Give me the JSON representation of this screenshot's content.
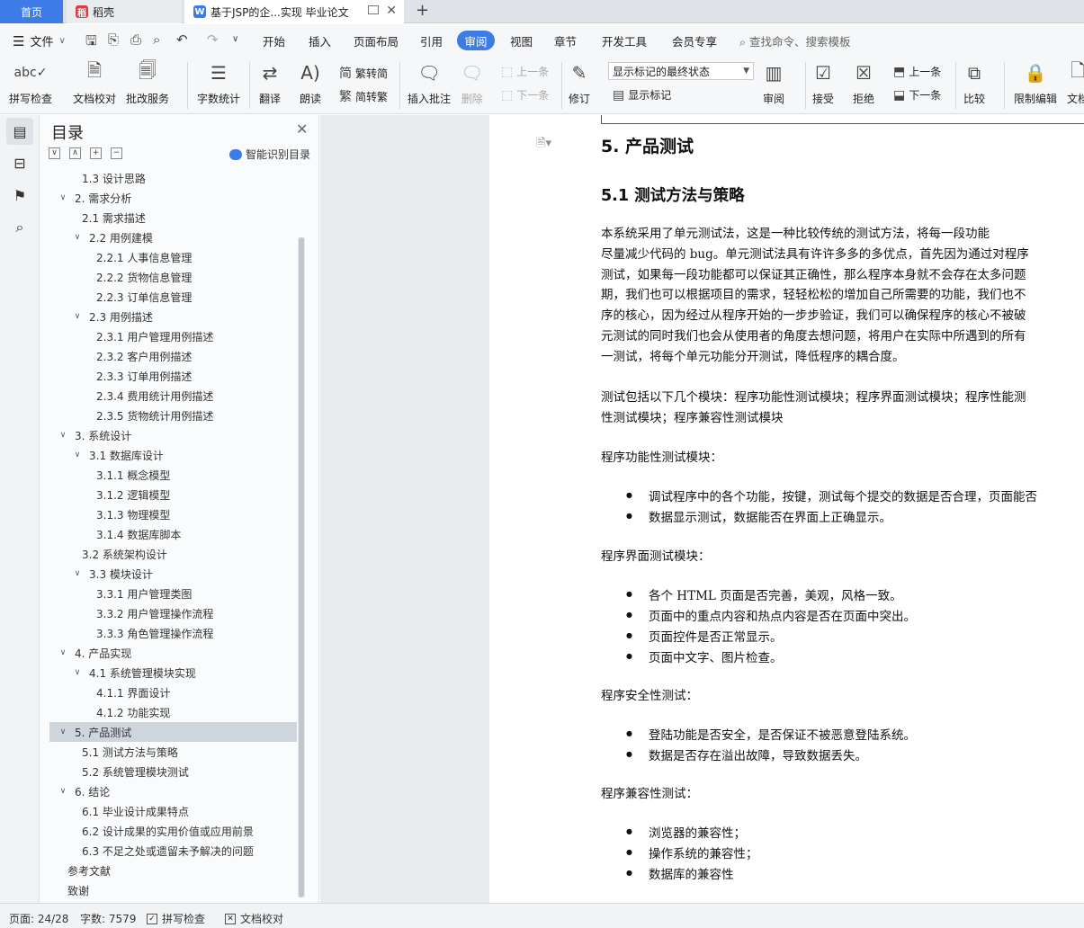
{
  "tabs": {
    "home": "首页",
    "daoke": "稻壳",
    "doc": "基于JSP的企...实现 毕业论文"
  },
  "menu": {
    "file": "文件",
    "items": [
      "开始",
      "插入",
      "页面布局",
      "引用",
      "视图",
      "章节",
      "开发工具",
      "会员专享"
    ],
    "active": "审阅",
    "search_placeholder": "查找命令、搜索模板"
  },
  "ribbon": {
    "spellcheck": "拼写检查",
    "doc_proof": "文档校对",
    "batch_review": "批改服务",
    "word_count": "字数统计",
    "translate": "翻译",
    "read_aloud": "朗读",
    "trad_to_simp": "繁转简",
    "simp_to_trad": "简转繁",
    "insert_comment": "插入批注",
    "delete": "删除",
    "prev_comment": "上一条",
    "next_comment": "下一条",
    "revise": "修订",
    "markup_mode": "显示标记的最终状态",
    "show_markup": "显示标记",
    "review": "审阅",
    "accept": "接受",
    "reject": "拒绝",
    "prev_change": "上一条",
    "next_change": "下一条",
    "compare": "比较",
    "restrict_edit": "限制编辑",
    "doc_cut": "文档"
  },
  "toc": {
    "title": "目录",
    "smart": "智能识别目录",
    "items": [
      {
        "text": "1.3 设计思路",
        "level": 2,
        "arrow": ""
      },
      {
        "text": "2.  需求分析",
        "level": 1,
        "arrow": "v"
      },
      {
        "text": "2.1  需求描述",
        "level": 2,
        "arrow": ""
      },
      {
        "text": "2.2  用例建模",
        "level": 2,
        "arrow": "v"
      },
      {
        "text": "2.2.1 人事信息管理",
        "level": 3,
        "arrow": ""
      },
      {
        "text": "2.2.2 货物信息管理",
        "level": 3,
        "arrow": ""
      },
      {
        "text": "2.2.3 订单信息管理",
        "level": 3,
        "arrow": ""
      },
      {
        "text": "2.3  用例描述",
        "level": 2,
        "arrow": "v"
      },
      {
        "text": "2.3.1  用户管理用例描述",
        "level": 3,
        "arrow": ""
      },
      {
        "text": "2.3.2  客户用例描述",
        "level": 3,
        "arrow": ""
      },
      {
        "text": "2.3.3  订单用例描述",
        "level": 3,
        "arrow": ""
      },
      {
        "text": "2.3.4  费用统计用例描述",
        "level": 3,
        "arrow": ""
      },
      {
        "text": "2.3.5  货物统计用例描述",
        "level": 3,
        "arrow": ""
      },
      {
        "text": "3.  系统设计",
        "level": 1,
        "arrow": "v"
      },
      {
        "text": "3.1  数据库设计",
        "level": 2,
        "arrow": "v"
      },
      {
        "text": "3.1.1  概念模型",
        "level": 3,
        "arrow": ""
      },
      {
        "text": "3.1.2  逻辑模型",
        "level": 3,
        "arrow": ""
      },
      {
        "text": "3.1.3  物理模型",
        "level": 3,
        "arrow": ""
      },
      {
        "text": "3.1.4  数据库脚本",
        "level": 3,
        "arrow": ""
      },
      {
        "text": "3.2  系统架构设计",
        "level": 2,
        "arrow": ""
      },
      {
        "text": "3.3  模块设计",
        "level": 2,
        "arrow": "v"
      },
      {
        "text": "3.3.1 用户管理类图",
        "level": 3,
        "arrow": ""
      },
      {
        "text": "3.3.2  用户管理操作流程",
        "level": 3,
        "arrow": ""
      },
      {
        "text": "3.3.3  角色管理操作流程",
        "level": 3,
        "arrow": ""
      },
      {
        "text": "4.  产品实现",
        "level": 1,
        "arrow": "v"
      },
      {
        "text": "4.1  系统管理模块实现",
        "level": 2,
        "arrow": "v"
      },
      {
        "text": "4.1.1  界面设计",
        "level": 3,
        "arrow": ""
      },
      {
        "text": "4.1.2  功能实现",
        "level": 3,
        "arrow": ""
      },
      {
        "text": "5.  产品测试",
        "level": 1,
        "arrow": "v",
        "selected": true
      },
      {
        "text": "5.1  测试方法与策略",
        "level": 2,
        "arrow": ""
      },
      {
        "text": "5.2 系统管理模块测试",
        "level": 2,
        "arrow": ""
      },
      {
        "text": "6.  结论",
        "level": 1,
        "arrow": "v"
      },
      {
        "text": "6.1 毕业设计成果特点",
        "level": 2,
        "arrow": ""
      },
      {
        "text": "6.2 设计成果的实用价值或应用前景",
        "level": 2,
        "arrow": ""
      },
      {
        "text": "6.3 不足之处或遗留未予解决的问题",
        "level": 2,
        "arrow": ""
      },
      {
        "text": "参考文献",
        "level": 0,
        "arrow": ""
      },
      {
        "text": "致谢",
        "level": 0,
        "arrow": ""
      }
    ]
  },
  "doc": {
    "h1": "5.   产品测试",
    "h2": "5.1  测试方法与策略",
    "paragraph1": [
      "        本系统采用了单元测试法，这是一种比较传统的测试方法，将每一段功能",
      "尽量减少代码的 bug。单元测试法具有许许多多的多优点，首先因为通过对程序",
      "测试，如果每一段功能都可以保证其正确性，那么程序本身就不会存在太多问题",
      "期，我们也可以根据项目的需求，轻轻松松的增加自己所需要的功能，我们也不",
      "序的核心，因为经过从程序开始的一步步验证，我们可以确保程序的核心不被破",
      "元测试的同时我们也会从使用者的角度去想问题，将用户在实际中所遇到的所有",
      "一测试，将每个单元功能分开测试，降低程序的耦合度。"
    ],
    "paragraph2": [
      "测试包括以下几个模块：程序功能性测试模块；程序界面测试模块；程序性能测",
      "性测试模块；程序兼容性测试模块"
    ],
    "sections": [
      {
        "title": "程序功能性测试模块：",
        "bullets": [
          "调试程序中的各个功能，按键，测试每个提交的数据是否合理，页面能否",
          "数据显示测试，数据能否在界面上正确显示。"
        ]
      },
      {
        "title": "程序界面测试模块：",
        "bullets": [
          "各个 HTML 页面是否完善，美观，风格一致。",
          "页面中的重点内容和热点内容是否在页面中突出。",
          "页面控件是否正常显示。",
          "页面中文字、图片检查。"
        ]
      },
      {
        "title": "程序安全性测试：",
        "bullets": [
          "登陆功能是否安全，是否保证不被恶意登陆系统。",
          "数据是否存在溢出故障，导致数据丢失。"
        ]
      },
      {
        "title": "程序兼容性测试：",
        "bullets": [
          "浏览器的兼容性；",
          "操作系统的兼容性；",
          "数据库的兼容性"
        ]
      }
    ]
  },
  "status": {
    "page": "页面: 24/28",
    "words": "字数: 7579",
    "spellcheck": "拼写检查",
    "proof": "文档校对"
  },
  "colors": {
    "accent": "#3d7be6",
    "toc_selected": "#cfd5dd"
  }
}
